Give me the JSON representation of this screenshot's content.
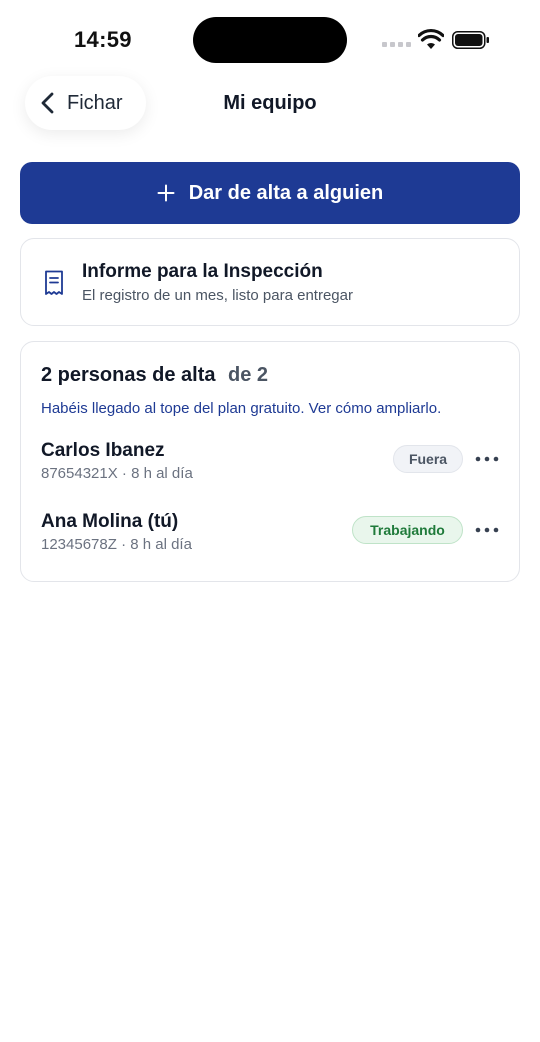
{
  "status_bar": {
    "time": "14:59"
  },
  "nav": {
    "back_label": "Fichar",
    "title": "Mi equipo"
  },
  "actions": {
    "add_label": "Dar de alta a alguien"
  },
  "report": {
    "title": "Informe para la Inspección",
    "subtitle": "El registro de un mes, listo para entregar"
  },
  "team": {
    "count_label": "2 personas de alta",
    "limit_label": "de 2",
    "notice": "Habéis llegado al tope del plan gratuito. Ver cómo ampliarlo.",
    "members": [
      {
        "name": "Carlos Ibanez",
        "meta": "87654321X · 8 h al día",
        "status": "Fuera"
      },
      {
        "name": "Ana Molina (tú)",
        "meta": "12345678Z · 8 h al día",
        "status": "Trabajando"
      }
    ]
  },
  "colors": {
    "primary": "#1e3a94",
    "working_text": "#1f7a3a",
    "working_bg": "#e9f6ec",
    "out_bg": "#f1f3f7"
  },
  "icons": [
    "signal-icon",
    "wifi-icon",
    "battery-icon",
    "chevron-left-icon",
    "plus-icon",
    "receipt-icon",
    "more-icon"
  ]
}
